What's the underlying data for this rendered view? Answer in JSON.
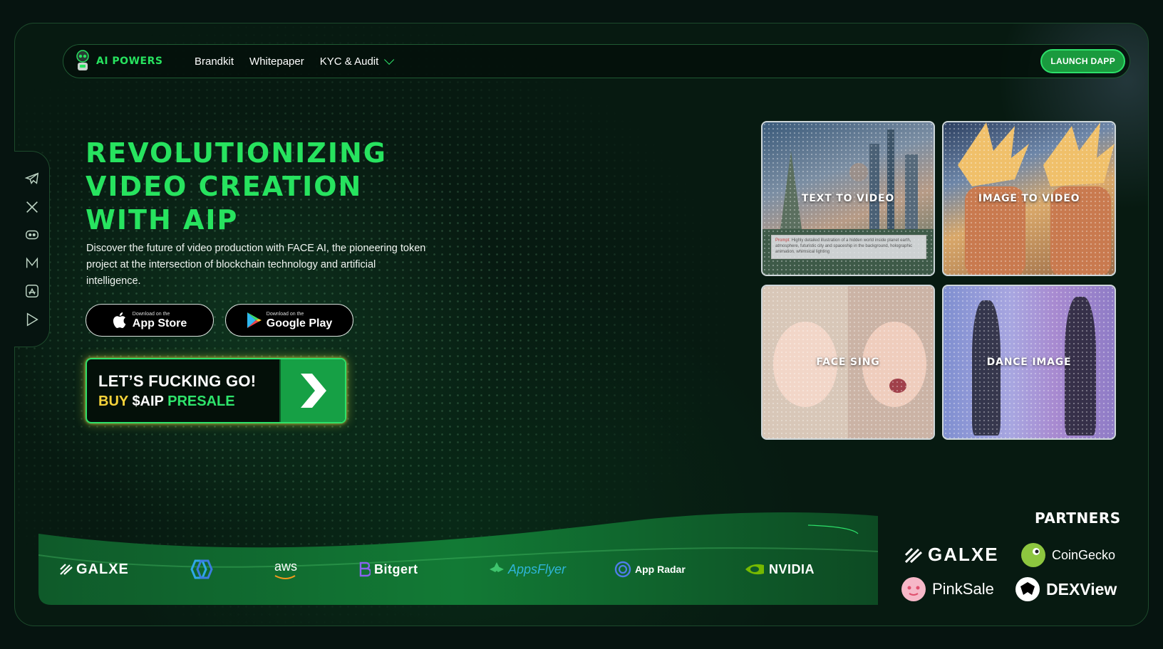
{
  "header": {
    "logo_text": "AI POWERS",
    "nav": [
      {
        "label": "Brandkit"
      },
      {
        "label": "Whitepaper"
      },
      {
        "label": "KYC & Audit"
      }
    ],
    "launch_label": "LAUNCH DAPP"
  },
  "sidebar": {
    "icons": [
      "telegram-icon",
      "x-icon",
      "discord-icon",
      "medium-icon",
      "app-store-icon",
      "google-play-icon"
    ]
  },
  "hero": {
    "title_lines": [
      "REVOLUTIONIZING",
      "VIDEO CREATION",
      "WITH AIP"
    ],
    "description": "Discover the future of video production with FACE AI, the pioneering token project at the intersection of blockchain technology and artificial intelligence.",
    "app_store": {
      "small": "Download on the",
      "big": "App Store"
    },
    "google_play": {
      "small": "Download on the",
      "big": "Google Play"
    },
    "cta": {
      "line1": "LET’S FUCKING GO!",
      "buy": "BUY",
      "ticker": "$AIP",
      "presale": "PRESALE"
    }
  },
  "tiles": [
    {
      "label": "TEXT TO VIDEO",
      "prompt_label": "Prompt:",
      "prompt": "Highly detailed illustration of a hidden world inside planet earth, atmosphere, futuristic city and spaceship in the background, holographic animation, whimsical lighting"
    },
    {
      "label": "IMAGE TO VIDEO"
    },
    {
      "label": "FACE SING"
    },
    {
      "label": "DANCE IMAGE"
    }
  ],
  "partners": {
    "title": "PARTNERS",
    "strip": [
      "GALXE",
      "",
      "aws",
      "Bitgert",
      "AppsFlyer",
      "App Radar",
      "NVIDIA"
    ],
    "featured": [
      "GALXE",
      "CoinGecko",
      "PinkSale",
      "DEXView"
    ]
  },
  "colors": {
    "accent_green": "#27e35f",
    "button_green": "#1a9a3e",
    "background": "#071a11",
    "presale_yellow": "#f6d33a"
  }
}
